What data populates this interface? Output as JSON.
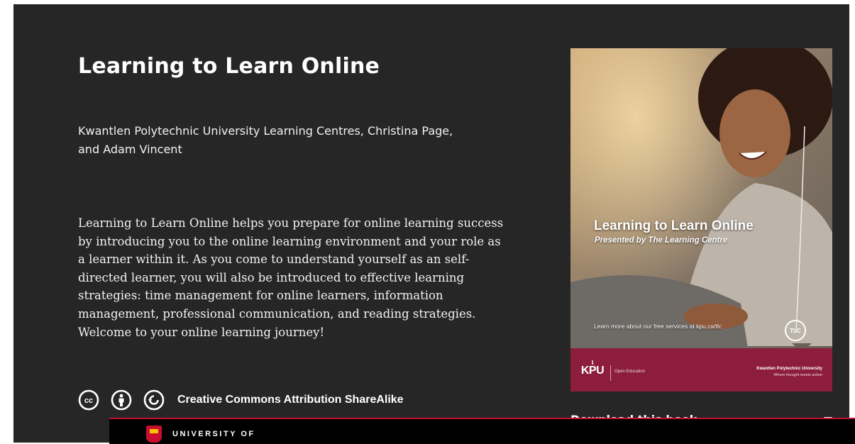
{
  "book": {
    "title": "Learning to Learn Online",
    "authors": "Kwantlen Polytechnic University Learning Centres, Christina Page, and Adam Vincent",
    "description": "Learning to Learn Online helps you prepare for online learning success by introducing you to the online learning environment and your role as a learner within it. As you come to understand yourself as an self-directed learner, you will also be introduced to effective learning strategies: time management for online learners, information management, professional communication, and reading strategies. Welcome to your online learning journey!",
    "license": {
      "label": "Creative Commons Attribution ShareAlike",
      "icons": [
        "cc-icon",
        "by-icon",
        "sa-icon"
      ]
    }
  },
  "cover": {
    "title": "Learning to Learn Online",
    "subtitle": "Presented by The Learning Centre",
    "footer_note": "Learn more about our free services at kpu.ca/tlc",
    "badge": "TLC",
    "logo_text": "KPU",
    "logo_caption": "Open Education",
    "institution": "Kwantlen Polytechnic University",
    "tagline": "Where thought meets action",
    "colors": {
      "band": "#8c1d3d"
    }
  },
  "download": {
    "label": "Download this book"
  },
  "footer": {
    "university_label": "UNIVERSITY OF"
  },
  "colors": {
    "hero_background": "#262626",
    "accent": "#c8102e"
  }
}
